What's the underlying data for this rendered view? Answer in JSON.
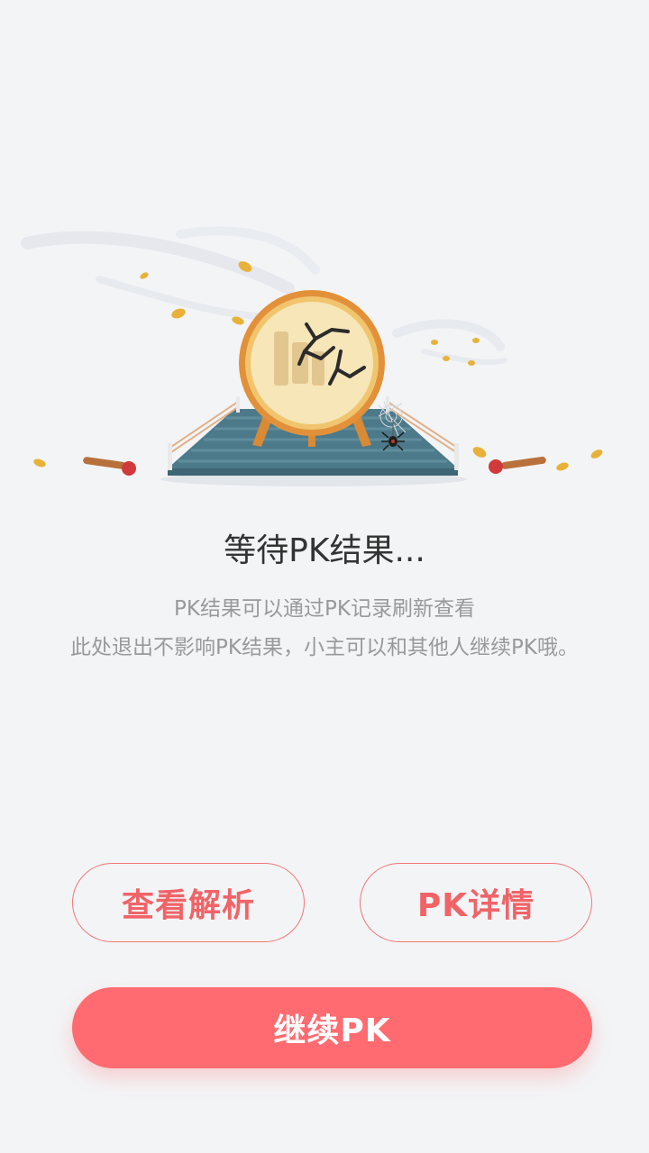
{
  "status": {
    "title": "等待PK结果...",
    "description_line1": "PK结果可以通过PK记录刷新查看",
    "description_line2": "此处退出不影响PK结果，小主可以和其他人继续PK哦。"
  },
  "illustration": {
    "icon": "cracked-gong-on-stage-illustration",
    "colors": {
      "stage": "#4d7a8a",
      "gong_rim": "#e2913a",
      "gong_face": "#f6e6b8",
      "mallet_head": "#d13a3a",
      "leaf": "#e8b23a"
    }
  },
  "actions": {
    "view_analysis_label": "查看解析",
    "pk_details_label": "PK详情",
    "continue_pk_label": "继续PK"
  },
  "colors": {
    "accent": "#ff6b70",
    "outline": "#f0787a",
    "background": "#f3f4f6"
  }
}
